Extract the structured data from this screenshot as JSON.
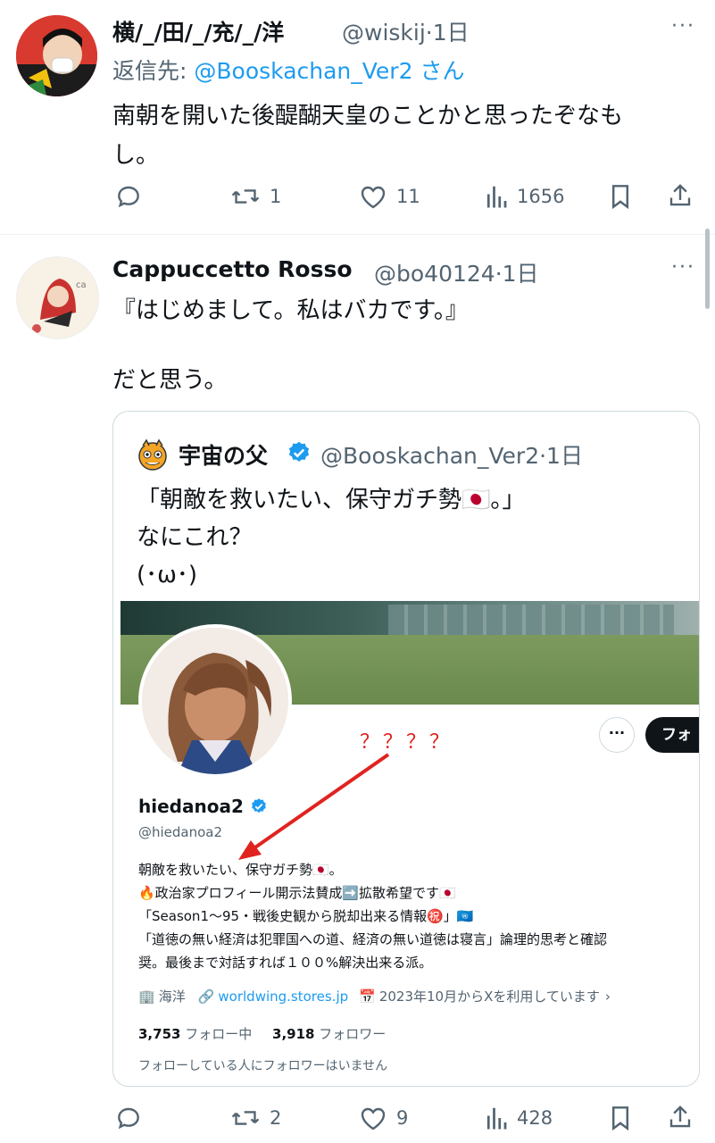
{
  "tweet1": {
    "name": "横/_/田/_/充/_/洋",
    "handle": "@wiskij",
    "time": "·1日",
    "reply_prefix": "返信先:",
    "reply_to": "@Booskachan_Ver2",
    "reply_suffix": "さん",
    "text_line1": "南朝を開いた後醍醐天皇のことかと思ったぞなも",
    "text_line2": "し。",
    "more": "···",
    "actions": {
      "reply": "",
      "retweet": "1",
      "like": "11",
      "views": "1656"
    }
  },
  "tweet2": {
    "name": "Cappuccetto Rosso",
    "handle": "@bo40124",
    "time": "·1日",
    "text_line1": "『はじめまして。私はバカです。』",
    "text_line2": "だと思う。",
    "more": "···",
    "actions": {
      "reply": "",
      "retweet": "2",
      "like": "9",
      "views": "428"
    }
  },
  "quote": {
    "name": "宇宙の父",
    "handle": "@Booskachan_Ver2",
    "time": "·1日",
    "text_line1": "「朝敵を救いたい、保守ガチ勢🇯🇵。」",
    "text_line2": "なにこれ？",
    "text_line3": "(･ω･)"
  },
  "profile": {
    "annotation": "？？？？",
    "follow_label": "フォ",
    "more": "···",
    "name": "hiedanoa2",
    "handle": "@hiedanoa2",
    "bio_line1": "朝敵を救いたい、保守ガチ勢🇯🇵。",
    "bio_line2": "🔥政治家プロフィール開示法賛成➡️拡散希望です🇯🇵",
    "bio_line3": "「Season1〜95・戦後史観から脱却出来る情報㊗️」🇺🇳",
    "bio_line4": "「道徳の無い経済は犯罪国への道、経済の無い道徳は寝言」論理的思考と確認",
    "bio_line5": "奨。最後まで対話すれば１００%解決出来る派。",
    "location": "海洋",
    "website": "worldwing.stores.jp",
    "joined": "2023年10月からXを利用しています",
    "following_count": "3,753",
    "following_label": "フォロー中",
    "followers_count": "3,918",
    "followers_label": "フォロワー",
    "no_mutual": "フォローしている人にフォロワーはいません"
  },
  "colors": {
    "accent": "#1d9bf0",
    "muted": "#536471",
    "annotation": "#e0231f"
  }
}
